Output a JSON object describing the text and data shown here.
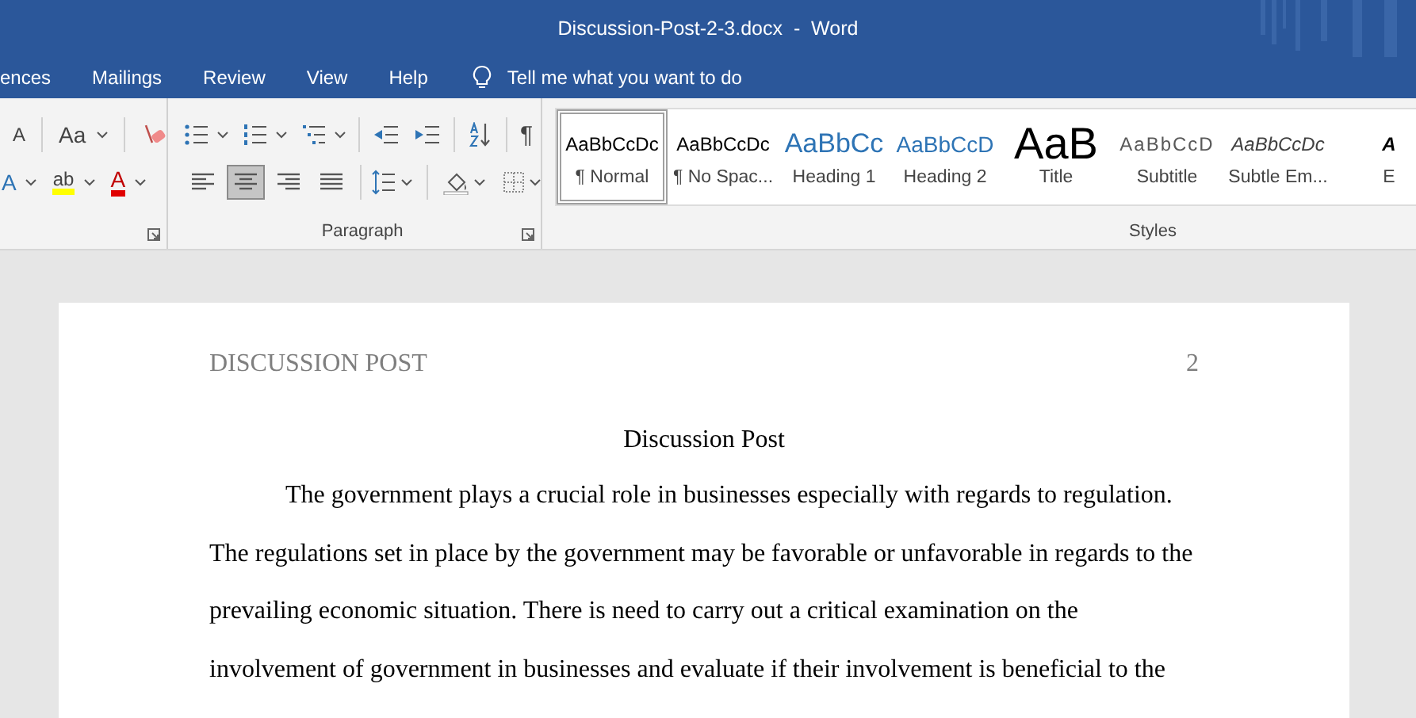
{
  "window": {
    "title": "Discussion-Post-2-3.docx  -  Word"
  },
  "ribbon_tabs": [
    {
      "label": "ences"
    },
    {
      "label": "Mailings"
    },
    {
      "label": "Review"
    },
    {
      "label": "View"
    },
    {
      "label": "Help"
    }
  ],
  "tell_me": {
    "placeholder": "Tell me what you want to do"
  },
  "font_group": {
    "shrink_glyph": "A",
    "change_case_glyph": "Aa",
    "effects_glyph": "A",
    "highlight_glyph": "ab",
    "font_color_glyph": "A"
  },
  "paragraph_group": {
    "label": "Paragraph",
    "show_marks_glyph": "¶",
    "alignments": [
      {
        "kind": "left",
        "selected": false
      },
      {
        "kind": "center",
        "selected": true
      },
      {
        "kind": "right",
        "selected": false
      },
      {
        "kind": "justify",
        "selected": false
      }
    ]
  },
  "styles_group": {
    "label": "Styles",
    "items": [
      {
        "kind": "normal",
        "preview": "AaBbCcDc",
        "name": "¶ Normal",
        "selected": true
      },
      {
        "kind": "normal",
        "preview": "AaBbCcDc",
        "name": "¶ No Spac...",
        "selected": false
      },
      {
        "kind": "heading1",
        "preview": "AaBbCc",
        "name": "Heading 1",
        "selected": false
      },
      {
        "kind": "heading2",
        "preview": "AaBbCcD",
        "name": "Heading 2",
        "selected": false
      },
      {
        "kind": "title",
        "preview": "AaB",
        "name": "Title",
        "selected": false
      },
      {
        "kind": "subtitle",
        "preview": "AaBbCcD",
        "name": "Subtitle",
        "selected": false
      },
      {
        "kind": "emphasis",
        "preview": "AaBbCcDc",
        "name": "Subtle Em...",
        "selected": false
      },
      {
        "kind": "strong",
        "preview": "A",
        "name": "E",
        "selected": false
      }
    ]
  },
  "document": {
    "header": "DISCUSSION POST",
    "page_number": "2",
    "title": "Discussion Post",
    "paragraph": "The government plays a crucial role in businesses especially with regards to regulation. The regulations set in place by the government may be favorable or unfavorable in regards to the prevailing economic situation. There is need to carry out a critical examination on the involvement of government in businesses and evaluate if their involvement is beneficial to the"
  }
}
